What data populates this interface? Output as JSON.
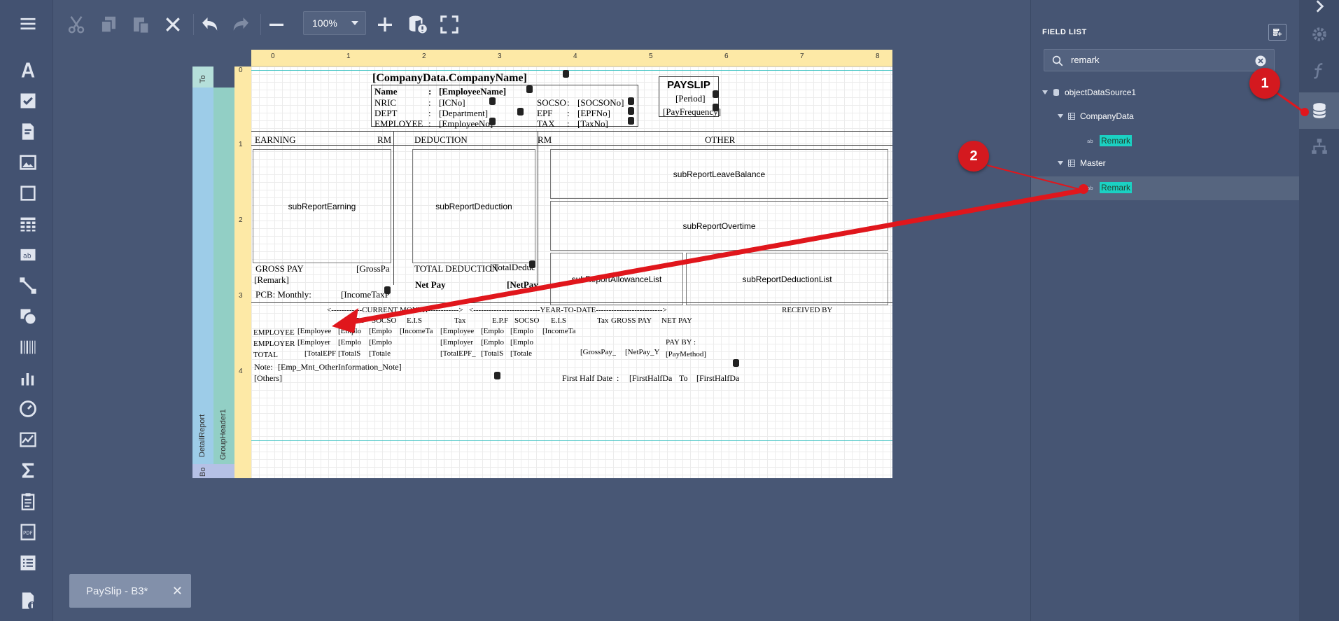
{
  "toolbar": {
    "zoom_value": "100%"
  },
  "report": {
    "company": "[CompanyData.CompanyName]",
    "payslip": "PAYSLIP",
    "period": "[Period]",
    "payfreq": "[PayFrequency]",
    "name_lbl": "Name",
    "name_val": "[EmployeeName]",
    "nric_lbl": "NRIC",
    "nric_val": "[ICNo]",
    "dept_lbl": "DEPT",
    "dept_val": "[Department]",
    "emp_lbl": "EMPLOYEE",
    "emp_val": "[EmployeeNo]",
    "socso_lbl": "SOCSO",
    "socso_val": "[SOCSONo]",
    "epf_lbl": "EPF",
    "epf_val": "[EPFNo]",
    "tax_lbl": "TAX",
    "tax_val": "[TaxNo]",
    "colon": ":",
    "earning": "EARNING",
    "rm": "RM",
    "deduction": "DEDUCTION",
    "other": "OTHER",
    "sub_earning": "subReportEarning",
    "sub_deduction": "subReportDeduction",
    "sub_leave": "subReportLeaveBalance",
    "sub_overtime": "subReportOvertime",
    "sub_allow": "subReportAllowanceList",
    "sub_dedlist": "subReportDeductionList",
    "gross_pay": "GROSS PAY",
    "gross_val": "[GrossPa",
    "total_ded": "TOTAL DEDUCTION",
    "total_ded_val": "[TotalDeducti",
    "remark": "[Remark]",
    "net_pay": "Net Pay",
    "net_pay_val": "[NetPay",
    "pcb": "PCB: Monthly:",
    "pcb_val": "[IncomeTaxPC",
    "cur_month": "<------------CURRENT MONTH------------>",
    "ytd": "<--------------------------YEAR-TO-DATE-------------------------->",
    "received_by": "RECEIVED BY",
    "c_epf": "E.P.F",
    "c_socso": "SOCSO",
    "c_eis": "E.I.S",
    "c_tax": "Tax",
    "c_gross": "GROSS PAY",
    "c_net": "NET PAY",
    "row_employee": "EMPLOYEE",
    "row_employer": "EMPLOYER",
    "row_total": "TOTAL",
    "v_employee": "[Employee",
    "v_empl": "[Emplo",
    "v_employer": "[Employer",
    "v_incometa": "[IncomeTa",
    "v_totalepf": "[TotalEPF",
    "v_totalepf2": "[TotalEPF_",
    "v_totals": "[TotalS",
    "v_totale": "[Totale",
    "v_grosspay": "[GrossPay_",
    "v_netpay": "[NetPay_Y",
    "pay_by": "PAY BY :",
    "pay_method": "[PayMethod]",
    "note_lbl": "Note:",
    "note_val": "[Emp_Mnt_OtherInformation_Note]",
    "others": "[Others]",
    "first_half": "First Half Date",
    "fh_val": "[FirstHalfDa",
    "to": "To",
    "fh_val2": "[FirstHalfDa"
  },
  "bands": {
    "top": "To",
    "detail": "DetailReport",
    "group": "GroupHeader1",
    "bottom": "Bo"
  },
  "ruler": {
    "h": [
      "0",
      "1",
      "2",
      "3",
      "4",
      "5",
      "6",
      "7",
      "8"
    ],
    "v": [
      "0",
      "1",
      "2",
      "3",
      "4"
    ]
  },
  "field_list": {
    "title": "FIELD LIST",
    "search_value": "remark",
    "items": [
      {
        "label": "objectDataSource1"
      },
      {
        "label": "CompanyData"
      },
      {
        "label": "Remark"
      },
      {
        "label": "Master"
      },
      {
        "label": "Remark"
      }
    ]
  },
  "callouts": [
    "1",
    "2"
  ],
  "doc_tab": {
    "label": "PaySlip - B3*",
    "close": "✕"
  }
}
